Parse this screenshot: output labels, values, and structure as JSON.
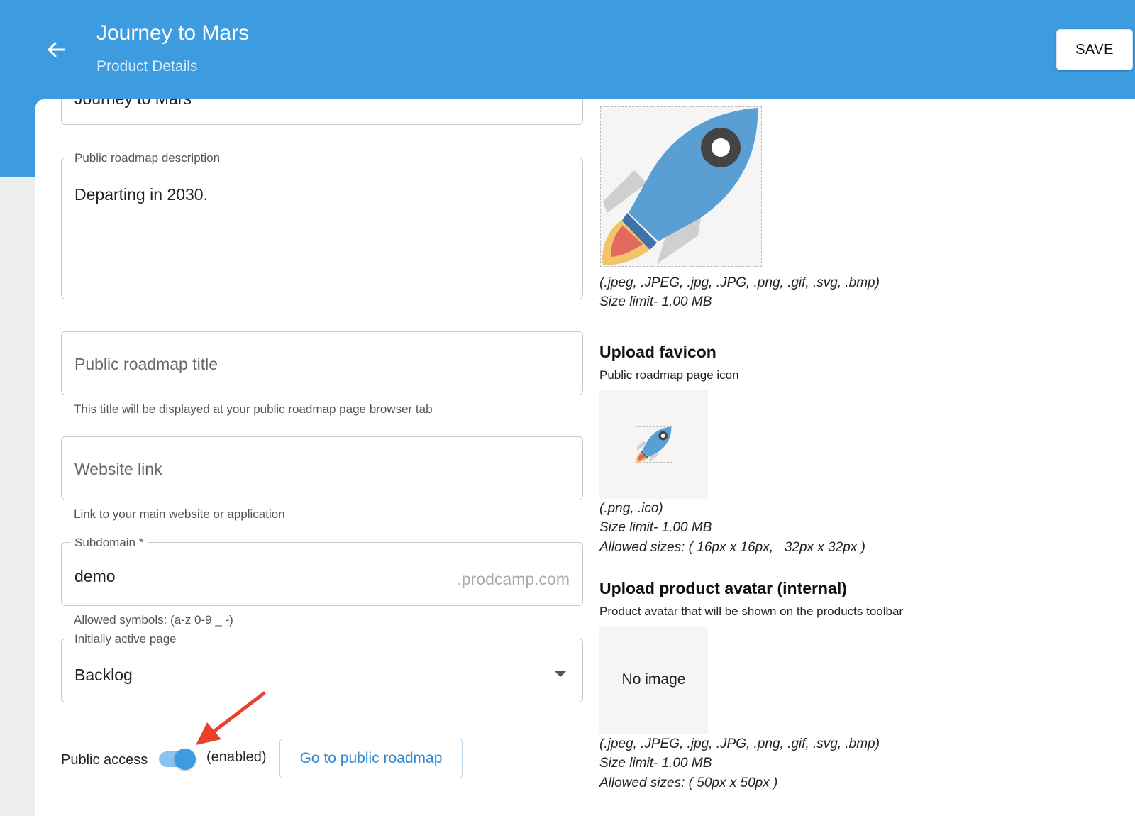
{
  "header": {
    "title": "Journey to Mars",
    "subtitle": "Product Details",
    "save_label": "SAVE",
    "back_icon": "arrow-left-icon"
  },
  "form": {
    "product_name": {
      "value": "Journey to Mars"
    },
    "description": {
      "label": "Public roadmap description",
      "value": "Departing in 2030."
    },
    "roadmap_title": {
      "placeholder": "Public roadmap title",
      "helper": "This title will be displayed at your public roadmap page browser tab"
    },
    "website_link": {
      "placeholder": "Website link",
      "helper": "Link to your main website or application"
    },
    "subdomain": {
      "label": "Subdomain *",
      "value": "demo",
      "suffix": ".prodcamp.com",
      "helper": "Allowed symbols: (a-z 0-9 _ -)"
    },
    "active_page": {
      "label": "Initially active page",
      "value": "Backlog"
    },
    "public_access": {
      "label": "Public access",
      "state": "(enabled)",
      "enabled": true,
      "button": "Go to public roadmap"
    }
  },
  "logo_upload": {
    "formats": "(.jpeg, .JPEG, .jpg, .JPG, .png, .gif, .svg, .bmp)",
    "size_limit": "Size limit- 1.00 MB"
  },
  "favicon_upload": {
    "title": "Upload favicon",
    "subtitle": "Public roadmap page icon",
    "formats": "(.png, .ico)",
    "size_limit": "Size limit- 1.00 MB",
    "allowed_sizes": "Allowed sizes: ( 16px x 16px,   32px x 32px )"
  },
  "avatar_upload": {
    "title": "Upload product avatar (internal)",
    "subtitle": "Product avatar that will be shown on the products toolbar",
    "empty_label": "No image",
    "formats": "(.jpeg, .JPEG, .jpg, .JPG, .png, .gif, .svg, .bmp)",
    "size_limit": "Size limit- 1.00 MB",
    "allowed_sizes": "Allowed sizes: ( 50px x 50px )"
  },
  "colors": {
    "primary": "#3d9be0",
    "annotation_arrow": "#e8412c",
    "rocket_body": "#5a9fd4",
    "rocket_fins": "#cfcfcf"
  }
}
